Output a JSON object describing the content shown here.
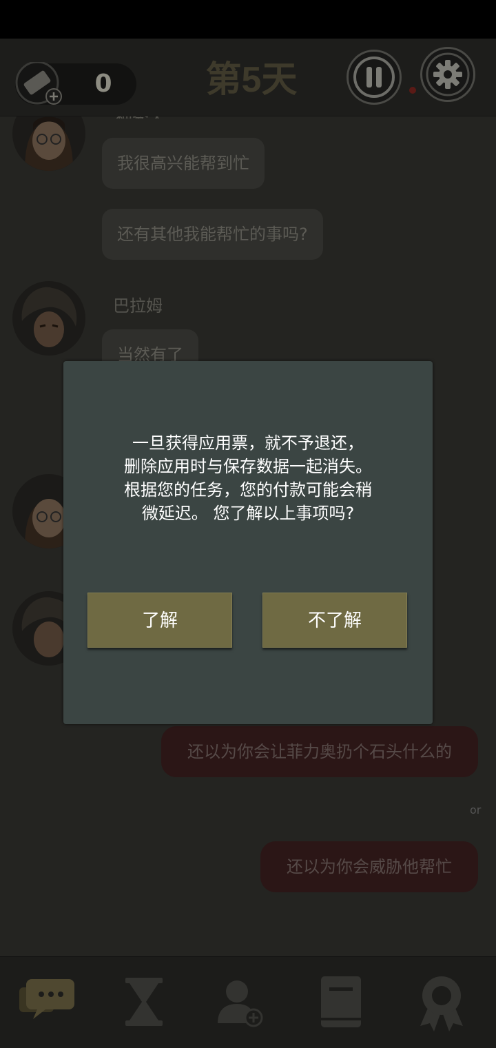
{
  "header": {
    "ticket_count": "0",
    "day_title": "第5天"
  },
  "chat": {
    "partial_name": "神秀天",
    "messages": [
      {
        "text": "我很高兴能帮到忙"
      },
      {
        "text": "还有其他我能帮忙的事吗?"
      }
    ],
    "speaker_name": "巴拉姆",
    "partial_message": "当然有了",
    "replies": [
      {
        "text": "还以为你会让菲力奥扔个石头什么的"
      },
      {
        "text": "还以为你会威胁他帮忙"
      }
    ],
    "or_label": "or"
  },
  "dialog": {
    "message_lines": [
      "一旦获得应用票，就不予退还，",
      "删除应用时与保存数据一起消失。",
      "根据您的任务，您的付款可能会稍",
      "微延迟。 您了解以上事项吗?"
    ],
    "ok_label": "了解",
    "cancel_label": "不了解"
  },
  "bottom_nav": {
    "icons": [
      "chat-icon",
      "hourglass-icon",
      "add-friend-icon",
      "book-icon",
      "award-icon"
    ]
  }
}
